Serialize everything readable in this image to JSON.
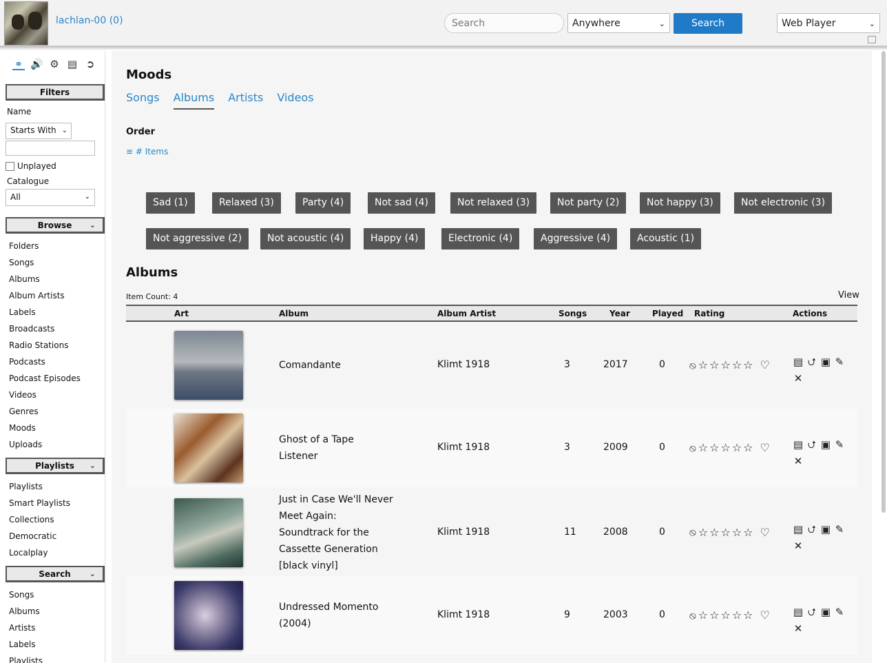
{
  "header": {
    "username": "lachlan-00 (0)",
    "search_placeholder": "Search",
    "search_scope": "Anywhere",
    "search_button": "Search",
    "player_mode": "Web Player"
  },
  "sidebar": {
    "filters_title": "Filters",
    "name_label": "Name",
    "name_mode": "Starts With",
    "unplayed_label": "Unplayed",
    "catalogue_label": "Catalogue",
    "catalogue_value": "All",
    "browse_title": "Browse",
    "browse_items": [
      "Folders",
      "Songs",
      "Albums",
      "Album Artists",
      "Labels",
      "Broadcasts",
      "Radio Stations",
      "Podcasts",
      "Podcast Episodes",
      "Videos",
      "Genres",
      "Moods",
      "Uploads"
    ],
    "playlists_title": "Playlists",
    "playlist_items": [
      "Playlists",
      "Smart Playlists",
      "Collections",
      "Democratic",
      "Localplay"
    ],
    "search_title": "Search",
    "search_items": [
      "Songs",
      "Albums",
      "Artists",
      "Labels",
      "Playlists"
    ]
  },
  "main": {
    "title": "Moods",
    "tabs": [
      "Songs",
      "Albums",
      "Artists",
      "Videos"
    ],
    "active_tab": "Albums",
    "order_label": "Order",
    "order_link": "# Items",
    "moods_row1": [
      "Sad (1)",
      "Relaxed (3)",
      "Party (4)",
      "Not sad (4)",
      "Not relaxed (3)",
      "Not party (2)",
      "Not happy (3)",
      "Not electronic (3)"
    ],
    "moods_row2": [
      "Not aggressive (2)",
      "Not acoustic (4)",
      "Happy (4)",
      "Electronic (4)",
      "Aggressive (4)",
      "Acoustic (1)"
    ],
    "albums_title": "Albums",
    "item_count": "Item Count: 4",
    "view_label": "View",
    "columns": {
      "art": "Art",
      "album": "Album",
      "artist": "Album Artist",
      "songs": "Songs",
      "year": "Year",
      "played": "Played",
      "rating": "Rating",
      "actions": "Actions"
    },
    "albums": [
      {
        "album": [
          "Comandante"
        ],
        "artist": "Klimt 1918",
        "songs": "3",
        "year": "2017",
        "played": "0"
      },
      {
        "album": [
          "Ghost of a Tape",
          "Listener"
        ],
        "artist": "Klimt 1918",
        "songs": "3",
        "year": "2009",
        "played": "0"
      },
      {
        "album": [
          "Just in Case We'll Never",
          "Meet Again:",
          "Soundtrack for the",
          "Cassette Generation",
          "[black vinyl]"
        ],
        "artist": "Klimt 1918",
        "songs": "11",
        "year": "2008",
        "played": "0"
      },
      {
        "album": [
          "Undressed Momento",
          "(2004)"
        ],
        "artist": "Klimt 1918",
        "songs": "9",
        "year": "2003",
        "played": "0"
      }
    ]
  }
}
